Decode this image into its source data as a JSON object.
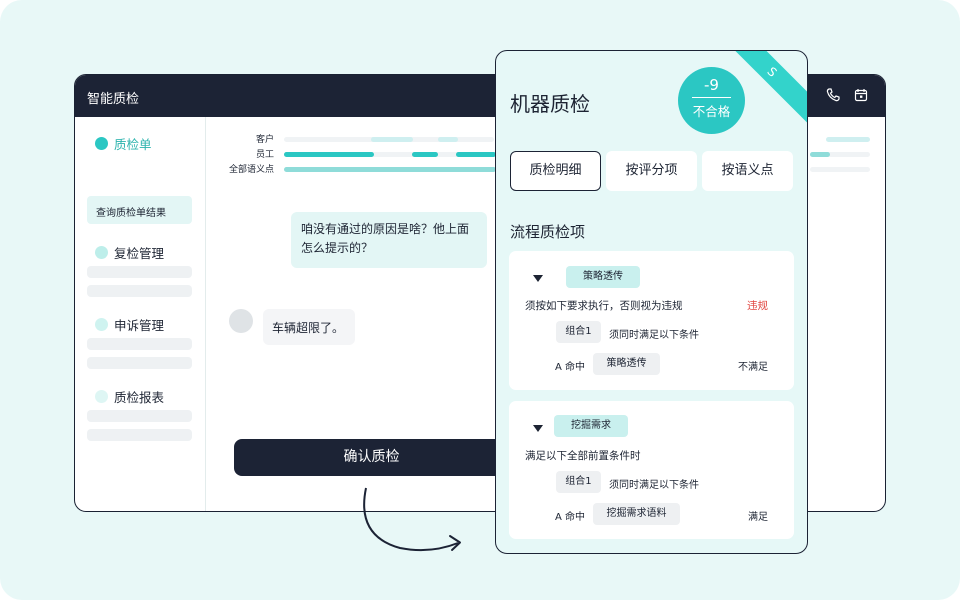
{
  "app": {
    "title": "智能质检"
  },
  "sidebar": {
    "items": [
      {
        "label": "质检单",
        "dot_color": "#2bc7c3",
        "active": true
      },
      {
        "label": "复检管理",
        "dot_color": "#bdeeea"
      },
      {
        "label": "申诉管理",
        "dot_color": "#cff3f0"
      },
      {
        "label": "质检报表",
        "dot_color": "#def6f4"
      }
    ],
    "sub_item": "查询质检单结果"
  },
  "timeline": {
    "labels": [
      "客户",
      "员工",
      "全部语义点"
    ]
  },
  "chat": {
    "agent_message": "咱没有通过的原因是啥？他上面怎么提示的？",
    "customer_message": "车辆超限了。"
  },
  "actions": {
    "confirm_label": "确认质检"
  },
  "panel": {
    "title": "机器质检",
    "score": "-9",
    "score_status": "不合格",
    "ribbon": "S",
    "tabs": [
      "质检明细",
      "按评分项",
      "按语义点"
    ],
    "active_tab": "质检明细",
    "section_title": "流程质检项",
    "cards": [
      {
        "tag": "策略透传",
        "rule": "须按如下要求执行，否则视为违规",
        "verdict": "违规",
        "group": "组合1",
        "group_desc": "须同时满足以下条件",
        "hit_prefix": "A 命中",
        "hit_tag": "策略透传",
        "result": "不满足"
      },
      {
        "tag": "挖掘需求",
        "rule": "满足以下全部前置条件时",
        "group": "组合1",
        "group_desc": "须同时满足以下条件",
        "hit_prefix": "A 命中",
        "hit_tag": "挖掘需求语料",
        "result": "满足"
      }
    ]
  },
  "colors": {
    "accent": "#2bc7c3",
    "dark": "#1c2335",
    "bg": "#e8f8f7",
    "violation": "#e0443e"
  }
}
